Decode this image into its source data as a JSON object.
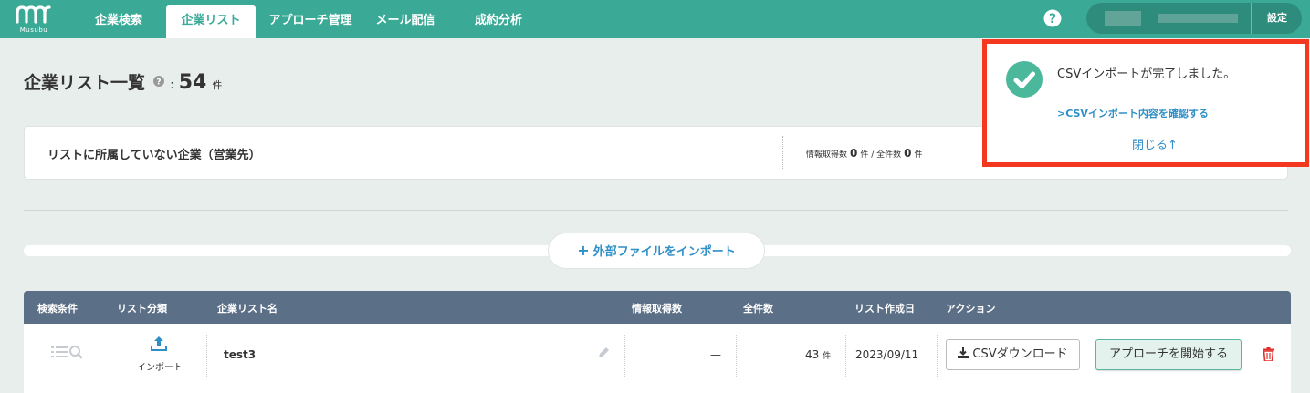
{
  "brand": {
    "logo_text": "Musubu"
  },
  "nav": {
    "items": [
      {
        "label": "企業検索"
      },
      {
        "label": "企業リスト"
      },
      {
        "label": "アプローチ管理"
      },
      {
        "label": "メール配信"
      },
      {
        "label": "成約分析"
      }
    ],
    "active": "企業リスト",
    "settings_label": "設定"
  },
  "page": {
    "title": "企業リスト一覧",
    "colon": ":",
    "count": "54",
    "count_unit": "件"
  },
  "unassigned": {
    "label": "リストに所属していない企業（営業先）",
    "info_label": "情報取得数",
    "info_value": "0",
    "info_unit": "件 /",
    "total_label": "全件数",
    "total_value": "0",
    "total_unit": "件"
  },
  "import_button": {
    "plus": "+",
    "label": "外部ファイルをインポート"
  },
  "table": {
    "columns": [
      "検索条件",
      "リスト分類",
      "企業リスト名",
      "情報取得数",
      "全件数",
      "リスト作成日",
      "アクション"
    ],
    "rows": [
      {
        "category": "インポート",
        "name": "test3",
        "info_count": "—",
        "total": "43",
        "total_unit": "件",
        "created": "2023/09/11",
        "csv_button": "CSVダウンロード",
        "approach_button": "アプローチを開始する"
      }
    ]
  },
  "toast": {
    "message": "CSVインポートが完了しました。",
    "link": "CSVインポート内容を確認する",
    "link_prefix": ">",
    "close": "閉じる",
    "close_arrow": "↑"
  },
  "colors": {
    "brand": "#3aa996",
    "table_header": "#5b6f87",
    "link": "#2f8fc7",
    "highlight": "#f4371f",
    "approach_bg": "#e3f2ec",
    "delete": "#e0312c"
  },
  "icons": [
    "logo-icon",
    "help-icon",
    "question-icon",
    "upload-icon",
    "search-list-icon",
    "edit-icon",
    "download-icon",
    "trash-icon",
    "check-circle-icon",
    "plus-icon"
  ]
}
